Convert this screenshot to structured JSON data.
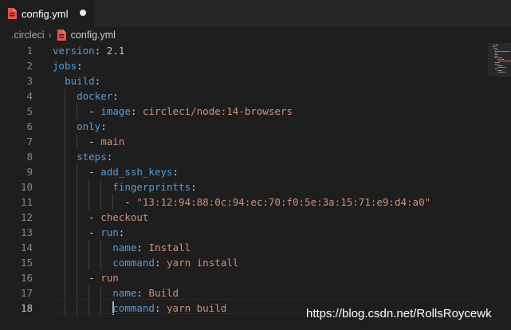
{
  "tab": {
    "filename": "config.yml",
    "icon": "yaml-file-icon",
    "unsaved": true
  },
  "breadcrumb": {
    "folder": ".circleci",
    "separator": "›",
    "file": "config.yml"
  },
  "colors": {
    "key": "#569cd6",
    "string": "#ce9178",
    "number": "#b5cea8",
    "punctuation": "#d4d4d4",
    "file_icon": "#e8524e"
  },
  "editor": {
    "current_line": 18,
    "lines": [
      {
        "num": "1",
        "tokens": [
          {
            "t": "k",
            "s": "version"
          },
          {
            "t": "p",
            "s": ": "
          },
          {
            "t": "n",
            "s": "2.1"
          }
        ]
      },
      {
        "num": "2",
        "tokens": [
          {
            "t": "k",
            "s": "jobs"
          },
          {
            "t": "p",
            "s": ":"
          }
        ]
      },
      {
        "num": "3",
        "tokens": [
          {
            "t": "p",
            "s": "  "
          },
          {
            "t": "k",
            "s": "build"
          },
          {
            "t": "p",
            "s": ":"
          }
        ]
      },
      {
        "num": "4",
        "tokens": [
          {
            "t": "p",
            "s": "    "
          },
          {
            "t": "k",
            "s": "docker"
          },
          {
            "t": "p",
            "s": ":"
          }
        ]
      },
      {
        "num": "5",
        "tokens": [
          {
            "t": "p",
            "s": "      - "
          },
          {
            "t": "k",
            "s": "image"
          },
          {
            "t": "p",
            "s": ": "
          },
          {
            "t": "v",
            "s": "circleci/node:14-browsers"
          }
        ]
      },
      {
        "num": "6",
        "tokens": [
          {
            "t": "p",
            "s": "    "
          },
          {
            "t": "k",
            "s": "only"
          },
          {
            "t": "p",
            "s": ":"
          }
        ]
      },
      {
        "num": "7",
        "tokens": [
          {
            "t": "p",
            "s": "      - "
          },
          {
            "t": "v",
            "s": "main"
          }
        ]
      },
      {
        "num": "8",
        "tokens": [
          {
            "t": "p",
            "s": "    "
          },
          {
            "t": "k",
            "s": "steps"
          },
          {
            "t": "p",
            "s": ":"
          }
        ]
      },
      {
        "num": "9",
        "tokens": [
          {
            "t": "p",
            "s": "      - "
          },
          {
            "t": "k",
            "s": "add_ssh_keys"
          },
          {
            "t": "p",
            "s": ":"
          }
        ]
      },
      {
        "num": "10",
        "tokens": [
          {
            "t": "p",
            "s": "          "
          },
          {
            "t": "k",
            "s": "fingerprintts"
          },
          {
            "t": "p",
            "s": ":"
          }
        ]
      },
      {
        "num": "11",
        "tokens": [
          {
            "t": "p",
            "s": "            - "
          },
          {
            "t": "v",
            "s": "\"13:12:94:88:0c:94:ec:70:f0:5e:3a:15:71:e9:d4:a0\""
          }
        ]
      },
      {
        "num": "12",
        "tokens": [
          {
            "t": "p",
            "s": "      - "
          },
          {
            "t": "v",
            "s": "checkout"
          }
        ]
      },
      {
        "num": "13",
        "tokens": [
          {
            "t": "p",
            "s": "      - "
          },
          {
            "t": "k",
            "s": "run"
          },
          {
            "t": "p",
            "s": ":"
          }
        ]
      },
      {
        "num": "14",
        "tokens": [
          {
            "t": "p",
            "s": "          "
          },
          {
            "t": "k",
            "s": "name"
          },
          {
            "t": "p",
            "s": ": "
          },
          {
            "t": "v",
            "s": "Install"
          }
        ]
      },
      {
        "num": "15",
        "tokens": [
          {
            "t": "p",
            "s": "          "
          },
          {
            "t": "k",
            "s": "command"
          },
          {
            "t": "p",
            "s": ": "
          },
          {
            "t": "v",
            "s": "yarn install"
          }
        ]
      },
      {
        "num": "16",
        "tokens": [
          {
            "t": "p",
            "s": "      - "
          },
          {
            "t": "v",
            "s": "run"
          }
        ]
      },
      {
        "num": "17",
        "tokens": [
          {
            "t": "p",
            "s": "          "
          },
          {
            "t": "k",
            "s": "name"
          },
          {
            "t": "p",
            "s": ": "
          },
          {
            "t": "v",
            "s": "Build"
          }
        ]
      },
      {
        "num": "18",
        "tokens": [
          {
            "t": "p",
            "s": "          "
          },
          {
            "t": "k",
            "s": "command"
          },
          {
            "t": "p",
            "s": ": "
          },
          {
            "t": "v",
            "s": "yarn build"
          }
        ]
      }
    ]
  },
  "watermark": "https://blog.csdn.net/RollsRoycewk"
}
